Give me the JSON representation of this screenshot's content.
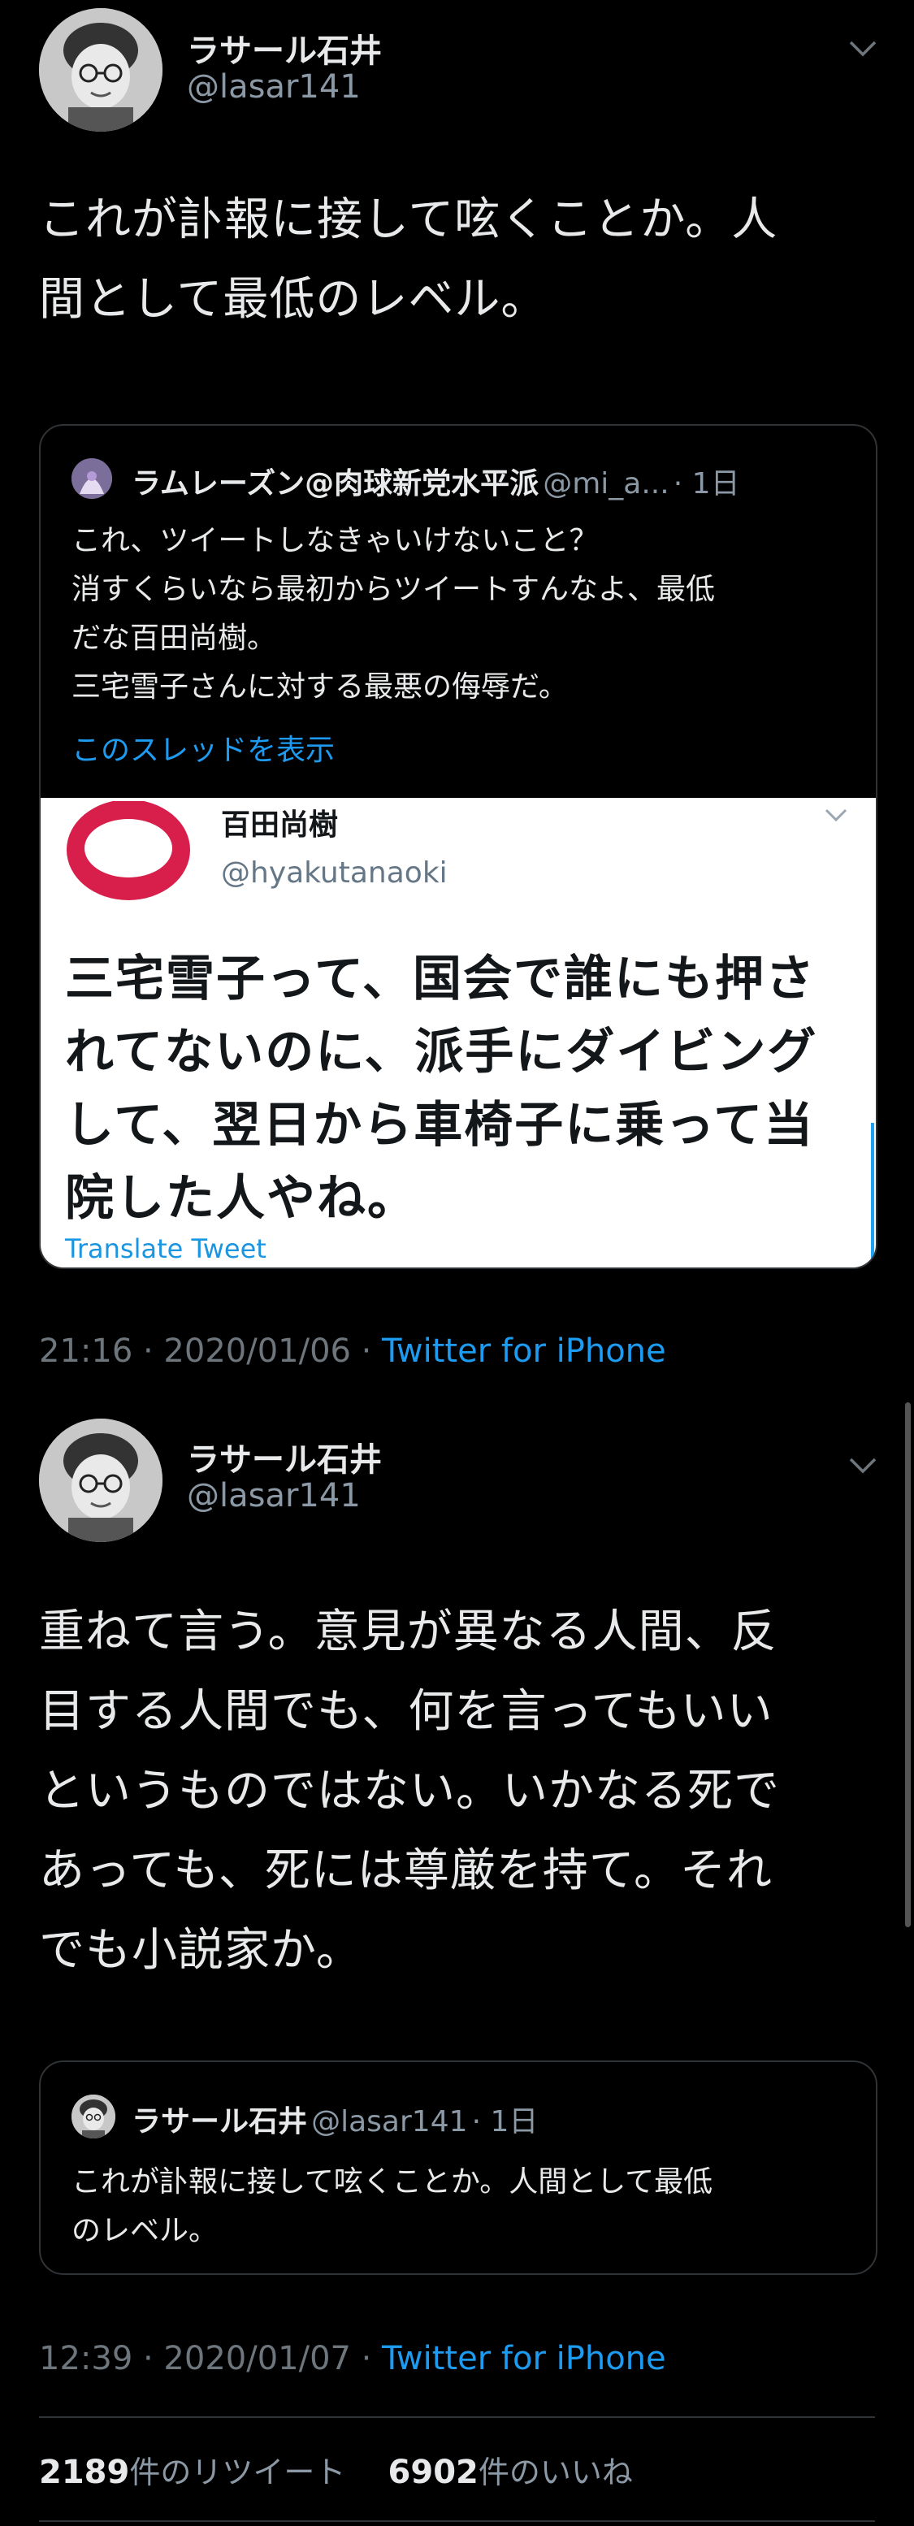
{
  "tweet1": {
    "name": "ラサール石井",
    "handle": "@lasar141",
    "text_lines": [
      "これが訃報に接して呟くことか。人",
      "間として最低のレベル。"
    ],
    "quoted": {
      "name": "ラムレーズン@肉球新党水平派",
      "handle": "@mi_a...",
      "time": "· 1日",
      "lines": [
        "これ、ツイートしなきゃいけないこと？",
        "消すくらいなら最初からツイートすんなよ、最低",
        "だな百田尚樹。",
        "三宅雪子さんに対する最悪の侮辱だ。"
      ],
      "thread_link": "このスレッドを表示",
      "embedded": {
        "name": "百田尚樹",
        "handle": "@hyakutanaoki",
        "lines": [
          "三宅雪子って、国会で誰にも押さ",
          "れてないのに、派手にダイビング",
          "して、翌日から車椅子に乗って当",
          "院した人やね。"
        ],
        "translate": "Translate Tweet"
      }
    },
    "timestamp": "21:16 · 2020/01/06 · ",
    "source": "Twitter for iPhone"
  },
  "tweet2": {
    "name": "ラサール石井",
    "handle": "@lasar141",
    "text_lines": [
      "重ねて言う。意見が異なる人間、反",
      "目する人間でも、何を言ってもいい",
      "というものではない。いかなる死で",
      "あっても、死には尊厳を持て。それ",
      "でも小説家か。"
    ],
    "quoted": {
      "name": "ラサール石井",
      "handle": "@lasar141",
      "time": "· 1日",
      "lines": [
        "これが訃報に接して呟くことか。人間として最低",
        "のレベル。"
      ]
    },
    "timestamp": "12:39 · 2020/01/07 · ",
    "source": "Twitter for iPhone"
  },
  "stats": {
    "retweets_count": "2189",
    "retweets_label": "件のリツイート",
    "likes_count": "6902",
    "likes_label": "件のいいね"
  },
  "icons": {
    "chevron": "chevron-down-icon",
    "avatar": "avatar-icon"
  },
  "colors": {
    "background": "#000000",
    "link": "#1d9bf0",
    "muted": "#6e767d"
  }
}
